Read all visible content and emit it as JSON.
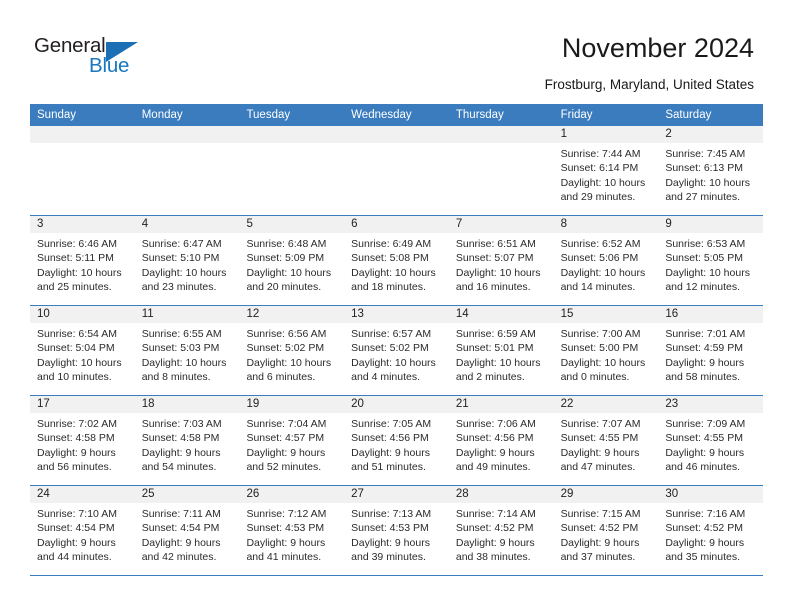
{
  "brand": {
    "name_top": "General",
    "name_bottom": "Blue",
    "accent_color": "#1878be",
    "triangle_color": "#1b6fb5"
  },
  "header": {
    "title": "November 2024",
    "subtitle": "Frostburg, Maryland, United States"
  },
  "calendar": {
    "header_bg": "#3a7cbe",
    "weekdays": [
      "Sunday",
      "Monday",
      "Tuesday",
      "Wednesday",
      "Thursday",
      "Friday",
      "Saturday"
    ],
    "weeks": [
      [
        {
          "day": "",
          "empty": true
        },
        {
          "day": "",
          "empty": true
        },
        {
          "day": "",
          "empty": true
        },
        {
          "day": "",
          "empty": true
        },
        {
          "day": "",
          "empty": true
        },
        {
          "day": "1",
          "sunrise": "Sunrise: 7:44 AM",
          "sunset": "Sunset: 6:14 PM",
          "daylight": "Daylight: 10 hours and 29 minutes."
        },
        {
          "day": "2",
          "sunrise": "Sunrise: 7:45 AM",
          "sunset": "Sunset: 6:13 PM",
          "daylight": "Daylight: 10 hours and 27 minutes."
        }
      ],
      [
        {
          "day": "3",
          "sunrise": "Sunrise: 6:46 AM",
          "sunset": "Sunset: 5:11 PM",
          "daylight": "Daylight: 10 hours and 25 minutes."
        },
        {
          "day": "4",
          "sunrise": "Sunrise: 6:47 AM",
          "sunset": "Sunset: 5:10 PM",
          "daylight": "Daylight: 10 hours and 23 minutes."
        },
        {
          "day": "5",
          "sunrise": "Sunrise: 6:48 AM",
          "sunset": "Sunset: 5:09 PM",
          "daylight": "Daylight: 10 hours and 20 minutes."
        },
        {
          "day": "6",
          "sunrise": "Sunrise: 6:49 AM",
          "sunset": "Sunset: 5:08 PM",
          "daylight": "Daylight: 10 hours and 18 minutes."
        },
        {
          "day": "7",
          "sunrise": "Sunrise: 6:51 AM",
          "sunset": "Sunset: 5:07 PM",
          "daylight": "Daylight: 10 hours and 16 minutes."
        },
        {
          "day": "8",
          "sunrise": "Sunrise: 6:52 AM",
          "sunset": "Sunset: 5:06 PM",
          "daylight": "Daylight: 10 hours and 14 minutes."
        },
        {
          "day": "9",
          "sunrise": "Sunrise: 6:53 AM",
          "sunset": "Sunset: 5:05 PM",
          "daylight": "Daylight: 10 hours and 12 minutes."
        }
      ],
      [
        {
          "day": "10",
          "sunrise": "Sunrise: 6:54 AM",
          "sunset": "Sunset: 5:04 PM",
          "daylight": "Daylight: 10 hours and 10 minutes."
        },
        {
          "day": "11",
          "sunrise": "Sunrise: 6:55 AM",
          "sunset": "Sunset: 5:03 PM",
          "daylight": "Daylight: 10 hours and 8 minutes."
        },
        {
          "day": "12",
          "sunrise": "Sunrise: 6:56 AM",
          "sunset": "Sunset: 5:02 PM",
          "daylight": "Daylight: 10 hours and 6 minutes."
        },
        {
          "day": "13",
          "sunrise": "Sunrise: 6:57 AM",
          "sunset": "Sunset: 5:02 PM",
          "daylight": "Daylight: 10 hours and 4 minutes."
        },
        {
          "day": "14",
          "sunrise": "Sunrise: 6:59 AM",
          "sunset": "Sunset: 5:01 PM",
          "daylight": "Daylight: 10 hours and 2 minutes."
        },
        {
          "day": "15",
          "sunrise": "Sunrise: 7:00 AM",
          "sunset": "Sunset: 5:00 PM",
          "daylight": "Daylight: 10 hours and 0 minutes."
        },
        {
          "day": "16",
          "sunrise": "Sunrise: 7:01 AM",
          "sunset": "Sunset: 4:59 PM",
          "daylight": "Daylight: 9 hours and 58 minutes."
        }
      ],
      [
        {
          "day": "17",
          "sunrise": "Sunrise: 7:02 AM",
          "sunset": "Sunset: 4:58 PM",
          "daylight": "Daylight: 9 hours and 56 minutes."
        },
        {
          "day": "18",
          "sunrise": "Sunrise: 7:03 AM",
          "sunset": "Sunset: 4:58 PM",
          "daylight": "Daylight: 9 hours and 54 minutes."
        },
        {
          "day": "19",
          "sunrise": "Sunrise: 7:04 AM",
          "sunset": "Sunset: 4:57 PM",
          "daylight": "Daylight: 9 hours and 52 minutes."
        },
        {
          "day": "20",
          "sunrise": "Sunrise: 7:05 AM",
          "sunset": "Sunset: 4:56 PM",
          "daylight": "Daylight: 9 hours and 51 minutes."
        },
        {
          "day": "21",
          "sunrise": "Sunrise: 7:06 AM",
          "sunset": "Sunset: 4:56 PM",
          "daylight": "Daylight: 9 hours and 49 minutes."
        },
        {
          "day": "22",
          "sunrise": "Sunrise: 7:07 AM",
          "sunset": "Sunset: 4:55 PM",
          "daylight": "Daylight: 9 hours and 47 minutes."
        },
        {
          "day": "23",
          "sunrise": "Sunrise: 7:09 AM",
          "sunset": "Sunset: 4:55 PM",
          "daylight": "Daylight: 9 hours and 46 minutes."
        }
      ],
      [
        {
          "day": "24",
          "sunrise": "Sunrise: 7:10 AM",
          "sunset": "Sunset: 4:54 PM",
          "daylight": "Daylight: 9 hours and 44 minutes."
        },
        {
          "day": "25",
          "sunrise": "Sunrise: 7:11 AM",
          "sunset": "Sunset: 4:54 PM",
          "daylight": "Daylight: 9 hours and 42 minutes."
        },
        {
          "day": "26",
          "sunrise": "Sunrise: 7:12 AM",
          "sunset": "Sunset: 4:53 PM",
          "daylight": "Daylight: 9 hours and 41 minutes."
        },
        {
          "day": "27",
          "sunrise": "Sunrise: 7:13 AM",
          "sunset": "Sunset: 4:53 PM",
          "daylight": "Daylight: 9 hours and 39 minutes."
        },
        {
          "day": "28",
          "sunrise": "Sunrise: 7:14 AM",
          "sunset": "Sunset: 4:52 PM",
          "daylight": "Daylight: 9 hours and 38 minutes."
        },
        {
          "day": "29",
          "sunrise": "Sunrise: 7:15 AM",
          "sunset": "Sunset: 4:52 PM",
          "daylight": "Daylight: 9 hours and 37 minutes."
        },
        {
          "day": "30",
          "sunrise": "Sunrise: 7:16 AM",
          "sunset": "Sunset: 4:52 PM",
          "daylight": "Daylight: 9 hours and 35 minutes."
        }
      ]
    ]
  }
}
